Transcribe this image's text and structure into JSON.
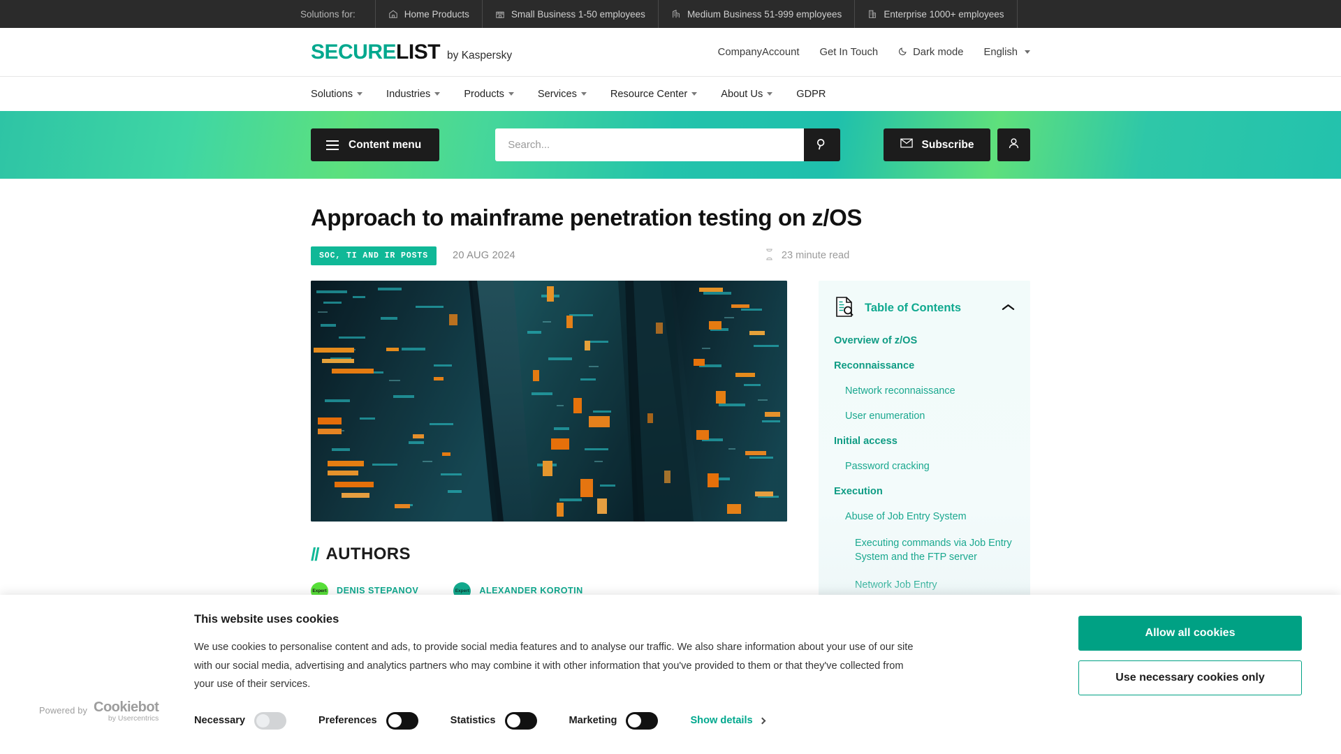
{
  "topbar": {
    "label": "Solutions for:",
    "items": [
      {
        "label": "Home Products",
        "icon": "home-icon"
      },
      {
        "label": "Small Business 1-50 employees",
        "icon": "storefront-icon"
      },
      {
        "label": "Medium Business 51-999 employees",
        "icon": "office-building-icon"
      },
      {
        "label": "Enterprise 1000+ employees",
        "icon": "enterprise-building-icon"
      }
    ]
  },
  "header": {
    "logo_secure": "SECURE",
    "logo_list": "LIST",
    "logo_by": "by Kaspersky",
    "right_links": [
      {
        "label": "CompanyAccount",
        "icon": ""
      },
      {
        "label": "Get In Touch",
        "icon": ""
      },
      {
        "label": "Dark mode",
        "icon": "moon-icon"
      },
      {
        "label": "English",
        "icon": "chevron-down-icon"
      }
    ]
  },
  "nav": {
    "items": [
      {
        "label": "Solutions",
        "has_caret": true
      },
      {
        "label": "Industries",
        "has_caret": true
      },
      {
        "label": "Products",
        "has_caret": true
      },
      {
        "label": "Services",
        "has_caret": true
      },
      {
        "label": "Resource Center",
        "has_caret": true
      },
      {
        "label": "About Us",
        "has_caret": true
      },
      {
        "label": "GDPR",
        "has_caret": false
      }
    ]
  },
  "searchband": {
    "content_menu_label": "Content menu",
    "search_placeholder": "Search...",
    "search_value": "",
    "subscribe_label": "Subscribe",
    "account_icon": "user-icon",
    "search_icon": "search-icon",
    "gradient_start": "#2ec4a5",
    "gradient_mid": "#5ce07e",
    "gradient_end": "#23c2ad"
  },
  "article": {
    "title": "Approach to mainframe penetration testing on z/OS",
    "category": "SOC, TI AND IR POSTS",
    "date": "20 AUG 2024",
    "read_time": "23 minute read",
    "read_icon": "hourglass-icon",
    "hero_alt": "Illuminated data center server racks seen from below"
  },
  "authors": {
    "heading": "AUTHORS",
    "slashes": "//",
    "list": [
      {
        "name": "DENIS STEPANOV",
        "badge": "Expert",
        "color": "#58e039"
      },
      {
        "name": "ALEXANDER KOROTIN",
        "badge": "Expert",
        "color": "#13a98d"
      }
    ]
  },
  "toc": {
    "title": "Table of Contents",
    "icon": "document-search-icon",
    "collapse_icon": "chevron-up-icon",
    "entries": [
      {
        "label": "Overview of z/OS",
        "level": 2
      },
      {
        "label": "Reconnaissance",
        "level": 2
      },
      {
        "label": "Network reconnaissance",
        "level": 3
      },
      {
        "label": "User enumeration",
        "level": 3
      },
      {
        "label": "Initial access",
        "level": 2
      },
      {
        "label": "Password cracking",
        "level": 3
      },
      {
        "label": "Execution",
        "level": 2
      },
      {
        "label": "Abuse of Job Entry System",
        "level": 3
      },
      {
        "label": "Executing commands via Job Entry System and the FTP server",
        "level": 4
      },
      {
        "label": "Network Job Entry",
        "level": 4
      }
    ]
  },
  "cookie": {
    "heading": "This website uses cookies",
    "body": "We use cookies to personalise content and ads, to provide social media features and to analyse our traffic. We also share information about your use of our site with our social media, advertising and analytics partners who may combine it with other information that you've provided to them or that they've collected from your use of their services.",
    "powered_by": "Powered by",
    "brand": "Cookiebot",
    "brand_sub": "by Usercentrics",
    "toggles": [
      {
        "label": "Necessary",
        "state": "on-locked"
      },
      {
        "label": "Preferences",
        "state": "off"
      },
      {
        "label": "Statistics",
        "state": "off"
      },
      {
        "label": "Marketing",
        "state": "off"
      }
    ],
    "show_details": "Show details",
    "allow_all": "Allow all cookies",
    "necessary_only": "Use necessary cookies only"
  }
}
